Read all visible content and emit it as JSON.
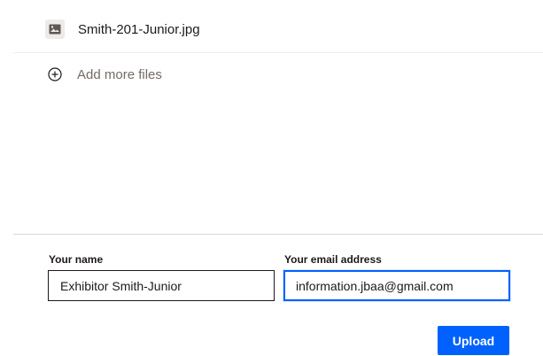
{
  "files": [
    {
      "name": "Smith-201-Junior.jpg",
      "icon": "image-file-icon"
    }
  ],
  "add_more": {
    "label": "Add more files",
    "icon": "plus-circle-icon"
  },
  "form": {
    "name_label": "Your name",
    "name_value": "Exhibitor Smith-Junior",
    "email_label": "Your email address",
    "email_value": "information.jbaa@gmail.com"
  },
  "upload_label": "Upload",
  "colors": {
    "accent": "#0061fe",
    "text": "#1e1919",
    "muted": "#736c64"
  }
}
